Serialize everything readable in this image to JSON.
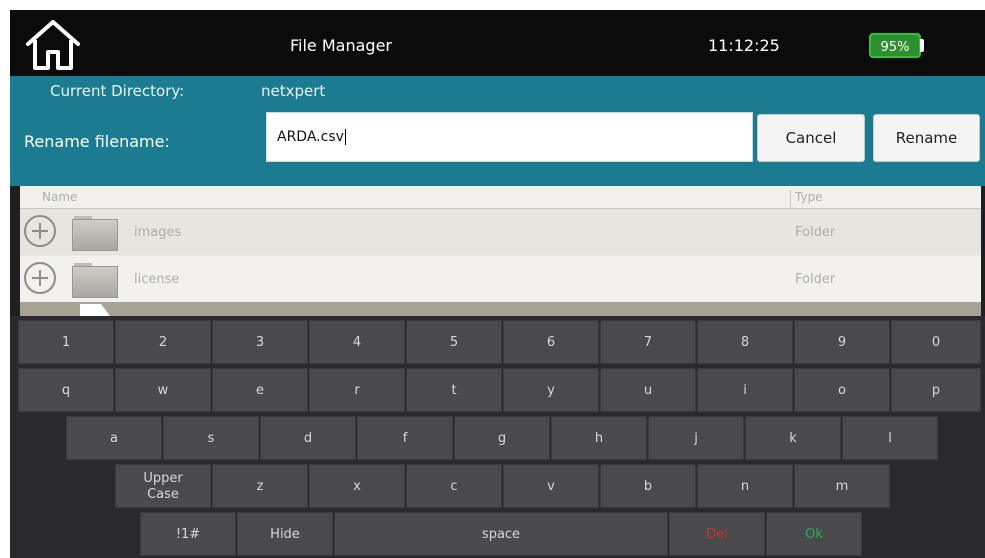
{
  "header": {
    "title": "File Manager",
    "time": "11:12:25",
    "battery": "95%",
    "battery_level": 0.95,
    "battery_color": "#2ec23a"
  },
  "panel": {
    "directory_label": "Current Directory:",
    "directory_value": "netxpert",
    "rename_label": "Rename filename:",
    "rename_value": "ARDA.csv",
    "cancel_label": "Cancel",
    "rename_button_label": "Rename",
    "accent_color": "#1b7b90"
  },
  "file_list": {
    "headers": {
      "name": "Name",
      "type": "Type"
    },
    "rows": [
      {
        "name": "images",
        "type": "Folder"
      },
      {
        "name": "license",
        "type": "Folder"
      }
    ]
  },
  "keyboard": {
    "row1": [
      "1",
      "2",
      "3",
      "4",
      "5",
      "6",
      "7",
      "8",
      "9",
      "0"
    ],
    "row2": [
      "q",
      "w",
      "e",
      "r",
      "t",
      "y",
      "u",
      "i",
      "o",
      "p"
    ],
    "row3": [
      "a",
      "s",
      "d",
      "f",
      "g",
      "h",
      "j",
      "k",
      "l"
    ],
    "row4": [
      "Upper Case",
      "z",
      "x",
      "c",
      "v",
      "b",
      "n",
      "m"
    ],
    "row5": [
      "!1#",
      "Hide",
      "space",
      "Del",
      "Ok"
    ]
  }
}
